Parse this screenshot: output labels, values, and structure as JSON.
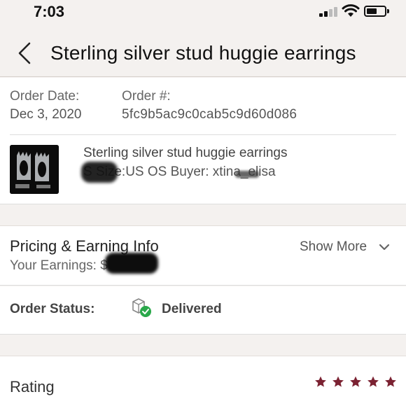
{
  "status_bar": {
    "time": "7:03"
  },
  "header": {
    "title": "Sterling silver stud huggie earrings",
    "back_icon": "chevron-left-icon"
  },
  "order": {
    "date_label": "Order Date:",
    "date_value": "Dec 3, 2020",
    "number_label": "Order #:",
    "number_value": "5fc9b5ac9c0cab5c9d60d086",
    "item": {
      "title": "Sterling silver stud huggie earrings",
      "meta": "S   Size:US OS  Buyer: xtina_elisa"
    }
  },
  "pricing": {
    "title": "Pricing & Earning Info",
    "earnings_label": "Your Earnings: $",
    "show_more": "Show More"
  },
  "status": {
    "label": "Order Status:",
    "value": "Delivered",
    "icon": "package-delivered-icon",
    "check_color": "#2aa84a"
  },
  "rating": {
    "label": "Rating",
    "stars": 5,
    "star_color": "#7b2232"
  }
}
